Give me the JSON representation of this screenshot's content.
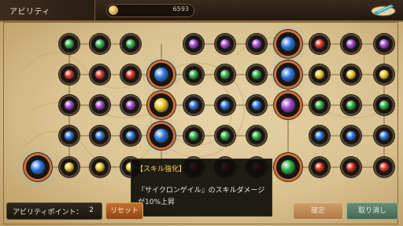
{
  "header": {
    "title": "アビリティ",
    "coin_value": "6593",
    "menu_icon": "feather-scroll-icon"
  },
  "tooltip": {
    "title": "【スキル強化】",
    "body": "『サイクロンゲイル』のスキルダメージが10%上昇"
  },
  "footer": {
    "points_label": "アビリティポイント：",
    "points_value": "2",
    "reset_label": "リセット",
    "confirm_label": "確定",
    "cancel_label": "取り消し"
  },
  "colors": {
    "green": "#2fae4a",
    "red": "#d8372a",
    "purple": "#a04ad0",
    "blue": "#2c78e0",
    "yellow": "#e8c62a",
    "accent_orange": "#c8733a"
  },
  "grid": {
    "rows": [
      [
        "green",
        "green",
        "green",
        "empty",
        "purple",
        "purple",
        "purple",
        "bigblue",
        "red",
        "purple",
        "purple"
      ],
      [
        "red",
        "red",
        "red",
        "bigblue",
        "green",
        "green",
        "green",
        "bigblue",
        "yellow",
        "yellow",
        "yellow"
      ],
      [
        "purple",
        "purple",
        "purple",
        "bigyellow",
        "blue",
        "blue",
        "blue",
        "bigpurple",
        "green",
        "green",
        "green"
      ],
      [
        "blue",
        "blue",
        "blue",
        "bigblue",
        "green",
        "green",
        "green",
        "empty",
        "blue",
        "blue",
        "blue"
      ],
      [
        "yellow",
        "yellow",
        "yellow",
        "empty",
        "red",
        "red",
        "red",
        "biggreen",
        "red",
        "red",
        "red"
      ]
    ],
    "extra_left_node": "bigblue"
  }
}
